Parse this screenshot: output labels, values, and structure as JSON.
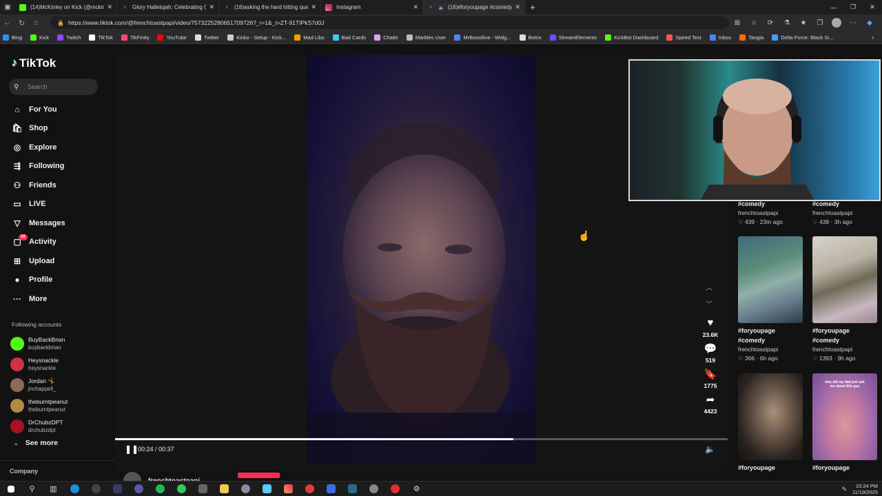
{
  "browser": {
    "tabs": [
      {
        "title": "(14)McKinley on Kick (@mckinley)",
        "color": "#53fc18",
        "active": false
      },
      {
        "title": "Glory Hallelujah: Celebrating Can",
        "color": "#ffffff",
        "active": false
      },
      {
        "title": "(16)asking the hard hitting questi",
        "color": "#ffffff",
        "active": false
      },
      {
        "title": "Instagram",
        "color": "#e1306c",
        "active": false
      },
      {
        "title": "(16)#foryoupage #comedy |",
        "color": "#ffffff",
        "active": true
      }
    ],
    "url": "https://www.tiktok.com/@frenchtoastpapi/video/7573225280651709726?_r=1&_t=ZT-91TIPkS7d0J",
    "bookmarks": [
      {
        "label": "Bing",
        "color": "#2f8ff0"
      },
      {
        "label": "Kick",
        "color": "#53fc18"
      },
      {
        "label": "Twitch",
        "color": "#9146ff"
      },
      {
        "label": "TikTok",
        "color": "#ffffff"
      },
      {
        "label": "TikFinity",
        "color": "#ff4a6e"
      },
      {
        "label": "YouTube",
        "color": "#ff0000"
      },
      {
        "label": "Twitter",
        "color": "#dddddd"
      },
      {
        "label": "Kinko - Setup - Kick...",
        "color": "#cccccc"
      },
      {
        "label": "Mad Libs",
        "color": "#f2a000"
      },
      {
        "label": "Bad Cards",
        "color": "#3ec6ff"
      },
      {
        "label": "Chatle",
        "color": "#e0a0ff"
      },
      {
        "label": "Marbles User",
        "color": "#bbbbbb"
      },
      {
        "label": "MrBoostlive - Widg...",
        "color": "#4488ff"
      },
      {
        "label": "Botrix",
        "color": "#dddddd"
      },
      {
        "label": "StreamElements",
        "color": "#6a4cff"
      },
      {
        "label": "KickBot Dashboard",
        "color": "#53fc18"
      },
      {
        "label": "Speed Test",
        "color": "#ff5555"
      },
      {
        "label": "Inbox",
        "color": "#4488ff"
      },
      {
        "label": "Tangia",
        "color": "#ff6a00"
      },
      {
        "label": "Delta Force: Black Si...",
        "color": "#3fa0ff"
      }
    ]
  },
  "tiktok": {
    "logo": "TikTok",
    "search_placeholder": "Search",
    "menu": [
      {
        "label": "For You",
        "icon": "home-icon",
        "glyph": "⌂"
      },
      {
        "label": "Shop",
        "icon": "shop-icon",
        "glyph": "🛍"
      },
      {
        "label": "Explore",
        "icon": "compass-icon",
        "glyph": "◎"
      },
      {
        "label": "Following",
        "icon": "following-icon",
        "glyph": "⇶"
      },
      {
        "label": "Friends",
        "icon": "friends-icon",
        "glyph": "⚇"
      },
      {
        "label": "LIVE",
        "icon": "live-icon",
        "glyph": "▭"
      },
      {
        "label": "Messages",
        "icon": "messages-icon",
        "glyph": "▽"
      },
      {
        "label": "Activity",
        "icon": "activity-icon",
        "glyph": "▢",
        "badge": "16"
      },
      {
        "label": "Upload",
        "icon": "upload-icon",
        "glyph": "⊞"
      },
      {
        "label": "Profile",
        "icon": "profile-icon",
        "glyph": "●"
      },
      {
        "label": "More",
        "icon": "more-icon",
        "glyph": "···"
      }
    ],
    "following_header": "Following accounts",
    "following": [
      {
        "name": "BuyBackBrian",
        "handle": "buybackbrian",
        "color": "#53fc18"
      },
      {
        "name": "Heysnackle",
        "handle": "heysnackle",
        "color": "#cc3344"
      },
      {
        "name": "Jordan 🤸",
        "handle": "jnchappell_",
        "color": "#8a6a55"
      },
      {
        "name": "theburntpeanut",
        "handle": "theburntpeanut",
        "color": "#b08a40"
      },
      {
        "name": "DrChubzDPT",
        "handle": "drchubzdpt",
        "color": "#aa1122"
      }
    ],
    "see_more": "See more",
    "company": "Company"
  },
  "player": {
    "time": "00:24 / 00:37",
    "progress": 0.65,
    "creator": "frenchtoastpapi",
    "likes": "23.6K",
    "comments": "519",
    "saves": "1775",
    "shares": "4423"
  },
  "related": [
    {
      "tag": "#comedy",
      "author": "frenchtoastpapi",
      "meta": "♡ 439 · 23m ago"
    },
    {
      "tag": "#comedy",
      "author": "frenchtoastpapi",
      "meta": "♡ 438 · 3h ago"
    },
    {
      "tag1": "#foryoupage",
      "tag2": "#comedy",
      "author": "frenchtoastpapi",
      "meta": "♡ 366 · 6h ago"
    },
    {
      "tag1": "#foryoupage",
      "tag2": "#comedy",
      "author": "frenchtoastpapi",
      "meta": "♡ 1393 · 9h ago"
    },
    {
      "tag": "#foryoupage"
    },
    {
      "tag": "#foryoupage"
    }
  ],
  "related_thumb_caption": "why did my dad just ask me about this guy",
  "taskbar": {
    "time": "10:24 PM",
    "date": "11/19/2025"
  }
}
